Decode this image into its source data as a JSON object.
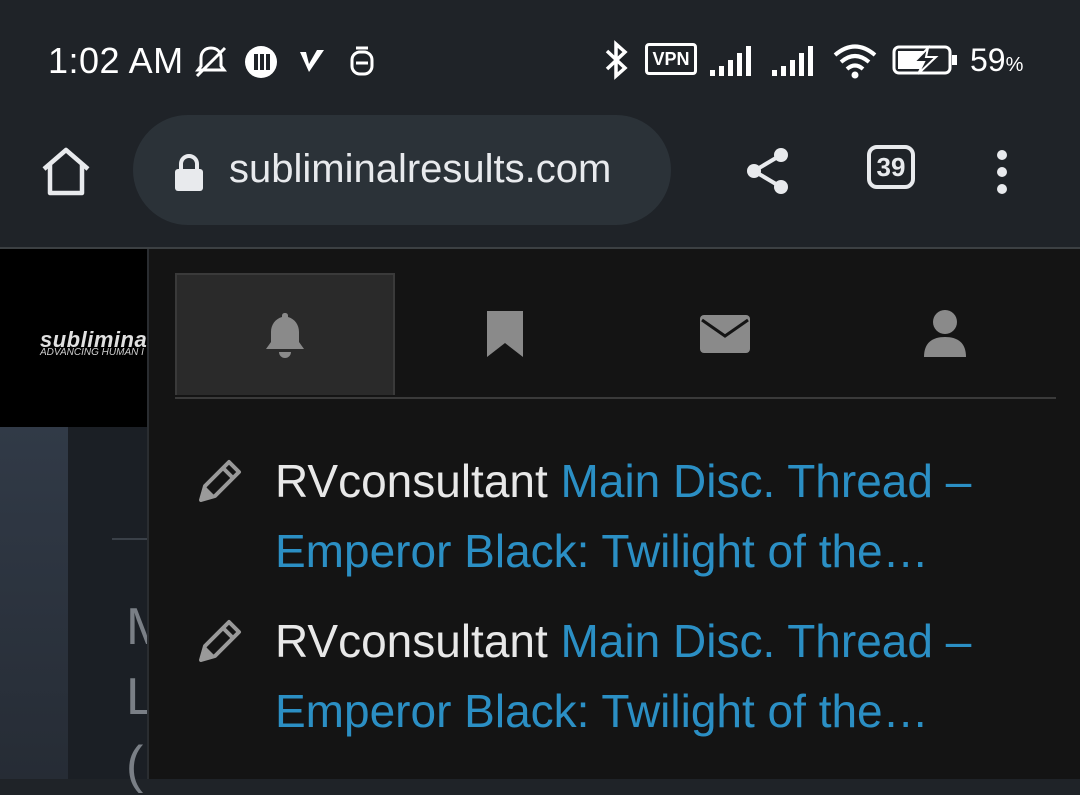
{
  "status_bar": {
    "time": "1:02 AM",
    "vpn_label": "VPN",
    "battery_percent": "59",
    "battery_unit": "%"
  },
  "browser": {
    "url": "subliminalresults.com",
    "tab_count": "39"
  },
  "site": {
    "logo_text": "subliminal",
    "logo_tagline": "ADVANCING HUMAN I"
  },
  "background_glyphs": [
    "M",
    "L",
    "("
  ],
  "dropdown": {
    "tabs": [
      {
        "name": "alerts",
        "icon": "bell-icon",
        "active": true
      },
      {
        "name": "bookmarks",
        "icon": "bookmark-icon",
        "active": false
      },
      {
        "name": "conversations",
        "icon": "envelope-icon",
        "active": false
      },
      {
        "name": "account",
        "icon": "user-icon",
        "active": false
      }
    ],
    "notifications": [
      {
        "user": "RVconsultant",
        "link": "Main Disc. Thread – Emperor Black: Twilight of the…"
      },
      {
        "user": "RVconsultant",
        "link": "Main Disc. Thread – Emperor Black: Twilight of the…"
      }
    ]
  },
  "colors": {
    "link": "#2b8fc4",
    "dropdown_bg": "#141414",
    "toolbar_bg": "#1f2328"
  }
}
